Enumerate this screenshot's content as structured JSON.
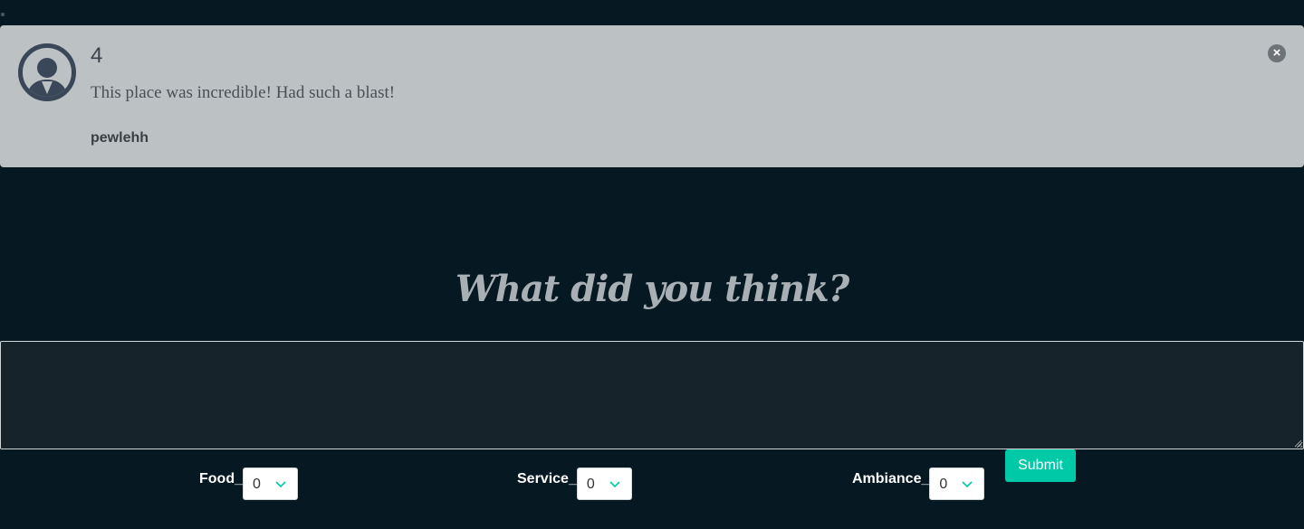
{
  "review": {
    "rating": "4",
    "text": "This place was incredible! Had such a blast!",
    "author": "pewlehh"
  },
  "icons": {
    "avatar": "user-avatar-icon",
    "close": "close-icon",
    "chevron": "chevron-down-icon"
  },
  "form": {
    "heading": "What did you think?",
    "comment_value": "",
    "submit_label": "Submit",
    "ratings": [
      {
        "label": "Food_",
        "value": "0"
      },
      {
        "label": "Service_",
        "value": "0"
      },
      {
        "label": "Ambiance_",
        "value": "0"
      }
    ]
  },
  "colors": {
    "background": "#061923",
    "card": "#bcc1c4",
    "accent": "#00c9a7",
    "heading": "#a8b0b5"
  }
}
